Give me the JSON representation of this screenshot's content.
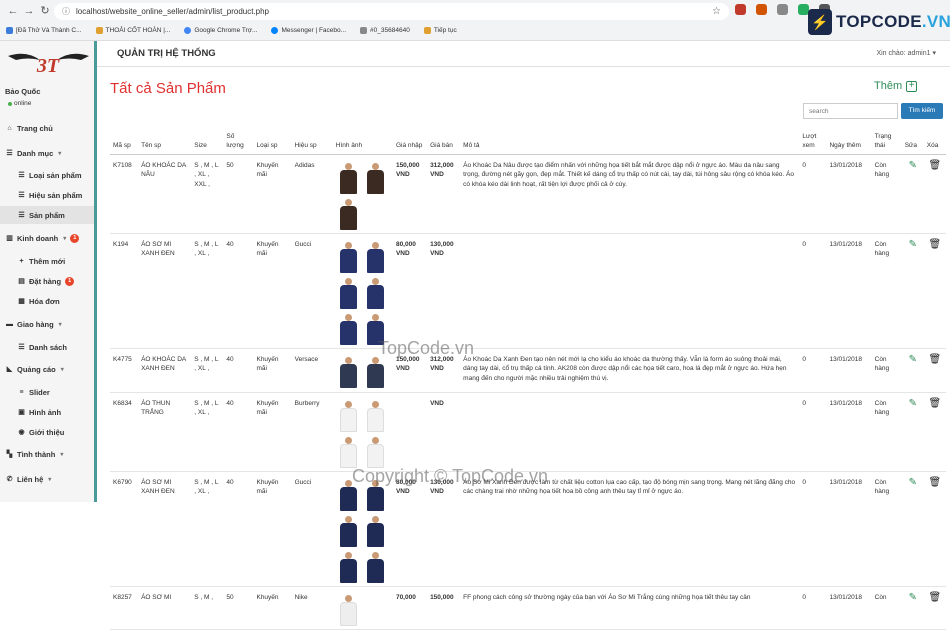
{
  "browser": {
    "url": "localhost/website_online_seller/admin/list_product.php",
    "bookmarks": [
      "[Đã Thử Và Thành C...",
      "THOẢI CỐT HOÀN |...",
      "Google Chrome Trợ...",
      "Messenger | Facebo...",
      "#0_35684640",
      "Tiếp tục"
    ]
  },
  "watermark": {
    "brand": "TOPCODE",
    "brand_suffix": ".VN",
    "center": "TopCode.vn",
    "bottom": "Copyright © TopCode.vn"
  },
  "sidebar": {
    "logo": "3T",
    "user_name": "Bảo Quốc",
    "user_status": "online",
    "items": [
      {
        "label": "Trang chủ",
        "icon": "home-icon"
      },
      {
        "label": "Danh mục",
        "icon": "list-icon"
      },
      {
        "label": "Loại sản phẩm",
        "icon": "list-icon"
      },
      {
        "label": "Hiệu sản phẩm",
        "icon": "list-icon"
      },
      {
        "label": "Sản phẩm",
        "icon": "list-icon"
      },
      {
        "label": "Kinh doanh",
        "icon": "chart-icon",
        "badge": "1"
      },
      {
        "label": "Thêm mới",
        "icon": "plus-icon"
      },
      {
        "label": "Đặt hàng",
        "icon": "cart-icon",
        "badge": "1"
      },
      {
        "label": "Hóa đơn",
        "icon": "invoice-icon"
      },
      {
        "label": "Giao hàng",
        "icon": "truck-icon"
      },
      {
        "label": "Danh sách",
        "icon": "list-icon"
      },
      {
        "label": "Quảng cáo",
        "icon": "megaphone-icon"
      },
      {
        "label": "Slider",
        "icon": "sliders-icon"
      },
      {
        "label": "Hình ảnh",
        "icon": "image-icon"
      },
      {
        "label": "Giới thiệu",
        "icon": "info-icon"
      },
      {
        "label": "Tình thành",
        "icon": "map-icon"
      },
      {
        "label": "Liên hệ",
        "icon": "phone-icon"
      }
    ]
  },
  "header": {
    "title": "QUẢN TRỊ HỆ THỐNG",
    "greeting": "Xin chào: admin1"
  },
  "main": {
    "title": "Tất cả Sản Phẩm",
    "add_label": "Thêm",
    "search_placeholder": "search",
    "search_button": "Tìm kiếm",
    "columns": [
      "Mã sp",
      "Tên sp",
      "Size",
      "Số lượng",
      "Loại sp",
      "Hiệu sp",
      "Hình ảnh",
      "Giá nhập",
      "Giá bán",
      "Mô tả",
      "Lượt xem",
      "Ngày thêm",
      "Trạng thái",
      "Sửa",
      "Xóa"
    ],
    "rows": [
      {
        "code": "K7108",
        "name": "ÁO KHOÁC DA NÂU",
        "size": "S , M , L , XL , XXL ,",
        "qty": "50",
        "type": "Khuyến mãi",
        "brand": "Adidas",
        "import": "150,000 VND",
        "price": "312,000 VND",
        "desc": "Áo Khoác Da Nâu được tạo điểm nhấn với những họa tiết bắt mắt được dập nổi ở ngực áo. Màu da nâu sang trọng, đường nét gãy gọn, đẹp mắt. Thiết kế dáng cổ trụ thấp có nút cài, tay dài, túi hông sâu rộng có khóa kéo. Áo có khóa kéo dài linh hoạt, rất tiện lợi được phối cả ở cùy.",
        "views": "0",
        "date": "13/01/2018",
        "status": "Còn hàng"
      },
      {
        "code": "K194",
        "name": "ÁO SƠ MI XANH ĐEN",
        "size": "S , M , L , XL ,",
        "qty": "40",
        "type": "Khuyến mãi",
        "brand": "Gucci",
        "import": "80,000 VND",
        "price": "130,000 VND",
        "desc": "",
        "views": "0",
        "date": "13/01/2018",
        "status": "Còn hàng"
      },
      {
        "code": "K4775",
        "name": "ÁO KHOÁC DA XANH ĐEN",
        "size": "S , M , L , XL ,",
        "qty": "40",
        "type": "Khuyến mãi",
        "brand": "Versace",
        "import": "150,000 VND",
        "price": "312,000 VND",
        "desc": "Áo Khoác Da Xanh Đen tạo nên nét mới lạ cho kiểu áo khoác da thường thấy. Vẫn là form áo suông thoải mái, dáng tay dài, cổ trụ thấp cá tính. AK208 còn được dập nổi các họa tiết caro, hoa lá đẹp mắt ở ngực áo. Hứa hẹn mang đến cho người mặc nhiều trải nghiệm thú vị.",
        "views": "0",
        "date": "13/01/2018",
        "status": "Còn hàng"
      },
      {
        "code": "K6834",
        "name": "ÁO THUN TRẮNG",
        "size": "S , M , L , XL ,",
        "qty": "40",
        "type": "Khuyến mãi",
        "brand": "Burberry",
        "import": "",
        "price": "VND",
        "desc": "",
        "views": "0",
        "date": "13/01/2018",
        "status": "Còn hàng"
      },
      {
        "code": "K6790",
        "name": "ÁO SƠ MI XANH ĐEN",
        "size": "S , M , L , XL ,",
        "qty": "40",
        "type": "Khuyến mãi",
        "brand": "Gucci",
        "import": "80,000 VND",
        "price": "130,000 VND",
        "desc": "Áo Sơ Mi Xanh Đen được làm từ chất liệu cotton lụa cao cấp, tạo độ bóng mịn sang trọng. Mang nét lãng đãng cho các chàng trai nhờ những họa tiết hoa bồ công anh thêu tay tỉ mỉ ở ngực áo.",
        "views": "0",
        "date": "13/01/2018",
        "status": "Còn hàng"
      },
      {
        "code": "K8257",
        "name": "ÁO SƠ MI",
        "size": "S , M ,",
        "qty": "50",
        "type": "Khuyến",
        "brand": "Nike",
        "import": "70,000",
        "price": "150,000",
        "desc": "FF phong cách công sở thường ngày của bạn với Áo Sơ Mi Trắng cùng những họa tiết thêu tay cân",
        "views": "0",
        "date": "13/01/2018",
        "status": "Còn"
      }
    ]
  },
  "colors": {
    "accent_red": "#e03030",
    "green": "#2e8b57",
    "button_blue": "#2a7ab8",
    "sidebar_border": "#4a9a99"
  }
}
